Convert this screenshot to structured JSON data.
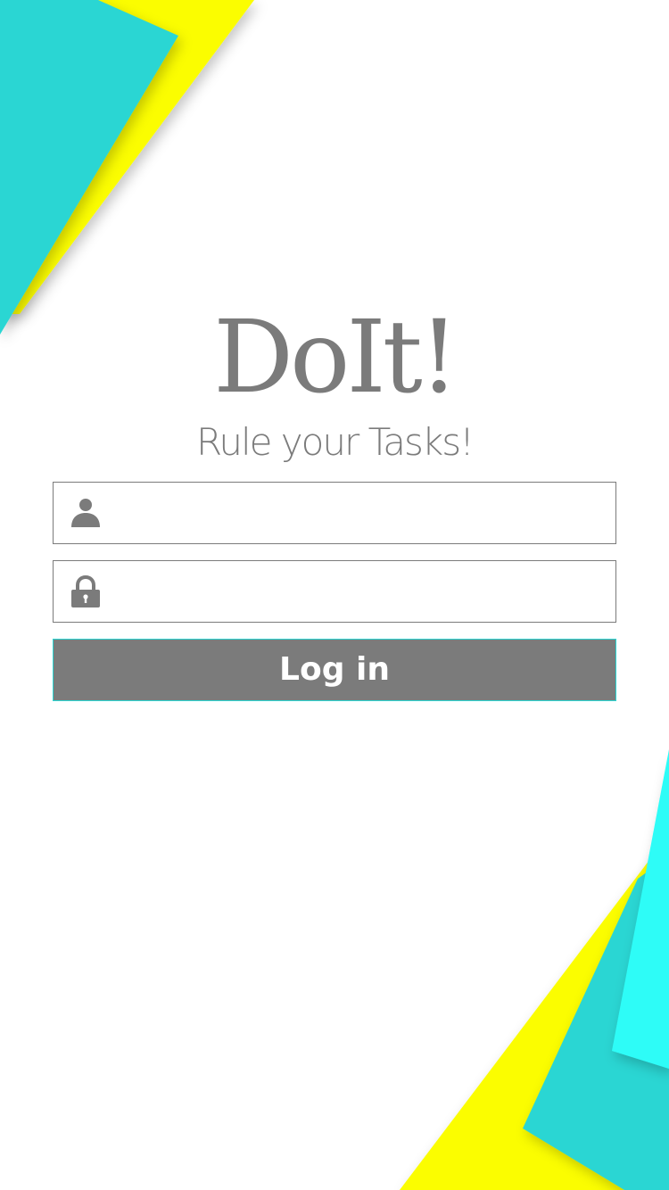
{
  "app": {
    "title": "DoIt!",
    "tagline": "Rule your Tasks!"
  },
  "login_form": {
    "username": {
      "icon": "user-icon",
      "value": "",
      "placeholder": ""
    },
    "password": {
      "icon": "lock-icon",
      "value": "",
      "placeholder": ""
    },
    "submit_label": "Log in"
  },
  "colors": {
    "teal": "#2bd6d3",
    "cyan": "#2efcf7",
    "yellow": "#fbfd00",
    "text_gray": "#7b7b7b",
    "button_gray": "#7b7b7b",
    "background": "#ffffff"
  }
}
